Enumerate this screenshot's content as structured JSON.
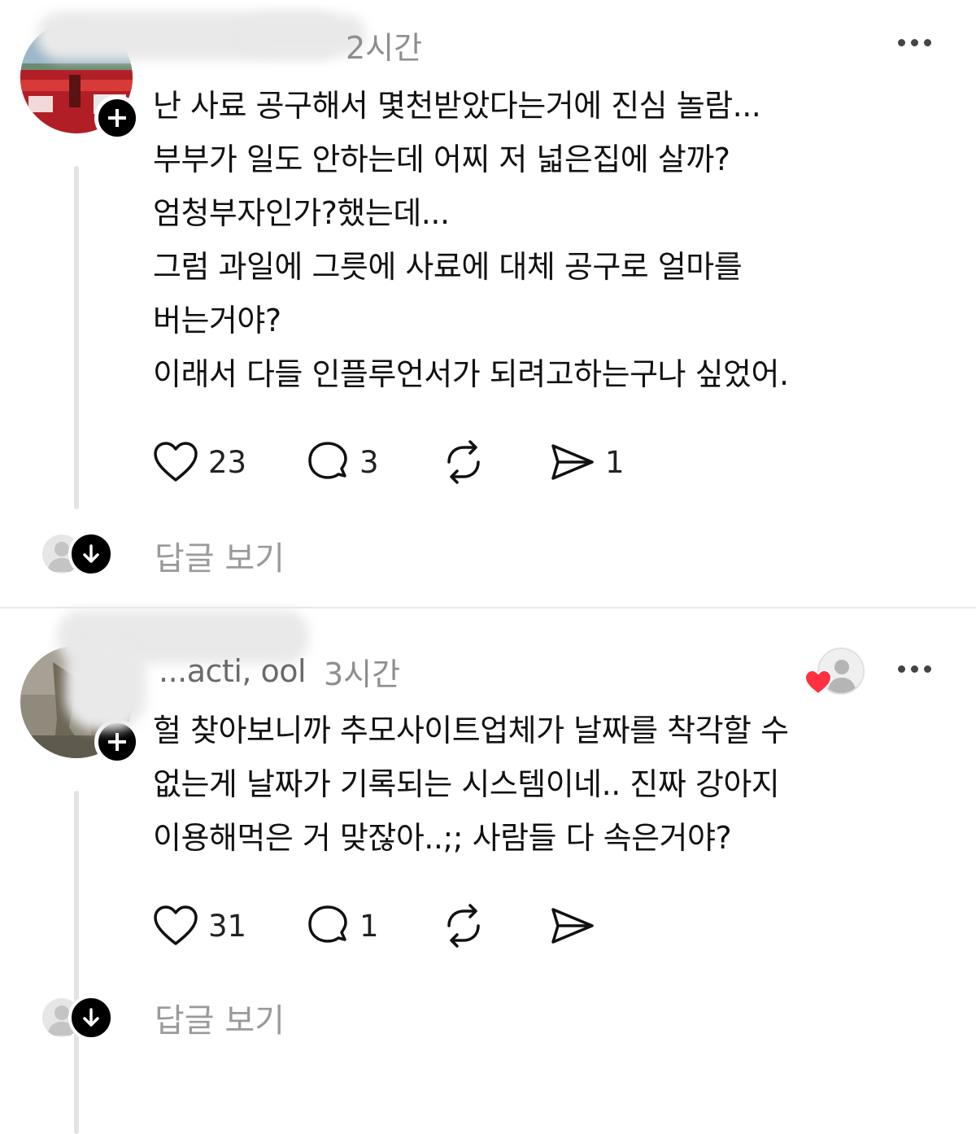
{
  "posts": [
    {
      "username": "",
      "time": "2시간",
      "lines": [
        "난 사료 공구해서 몇천받았다는거에 진심 놀람...",
        "부부가 일도 안하는데 어찌 저 넓은집에 살까?",
        "엄청부자인가?했는데...",
        "그럼 과일에 그릇에 사료에 대체 공구로 얼마를",
        "버는거야?",
        "이래서 다들 인플루언서가 되려고하는구나 싶었어."
      ],
      "likes": "23",
      "comments": "3",
      "reposts": "",
      "shares": "1",
      "view_replies": "답글 보기"
    },
    {
      "username": "...acti, ool",
      "time": "3시간",
      "lines": [
        "헐 찾아보니까 추모사이트업체가 날짜를 착각할 수",
        "없는게 날짜가 기록되는 시스템이네.. 진짜 강아지",
        "이용해먹은 거 맞잖아..;; 사람들 다 속은거야?"
      ],
      "likes": "31",
      "comments": "1",
      "reposts": "",
      "shares": "",
      "view_replies": "답글 보기",
      "author_liked": true
    }
  ],
  "colors": {
    "text": "#111111",
    "muted": "#8e8e8e",
    "heart_red": "#ff3040",
    "badge": "#000000"
  },
  "icons": [
    "heart-icon",
    "comment-icon",
    "repost-icon",
    "share-icon",
    "more-icon",
    "plus-icon",
    "arrow-down-icon"
  ]
}
